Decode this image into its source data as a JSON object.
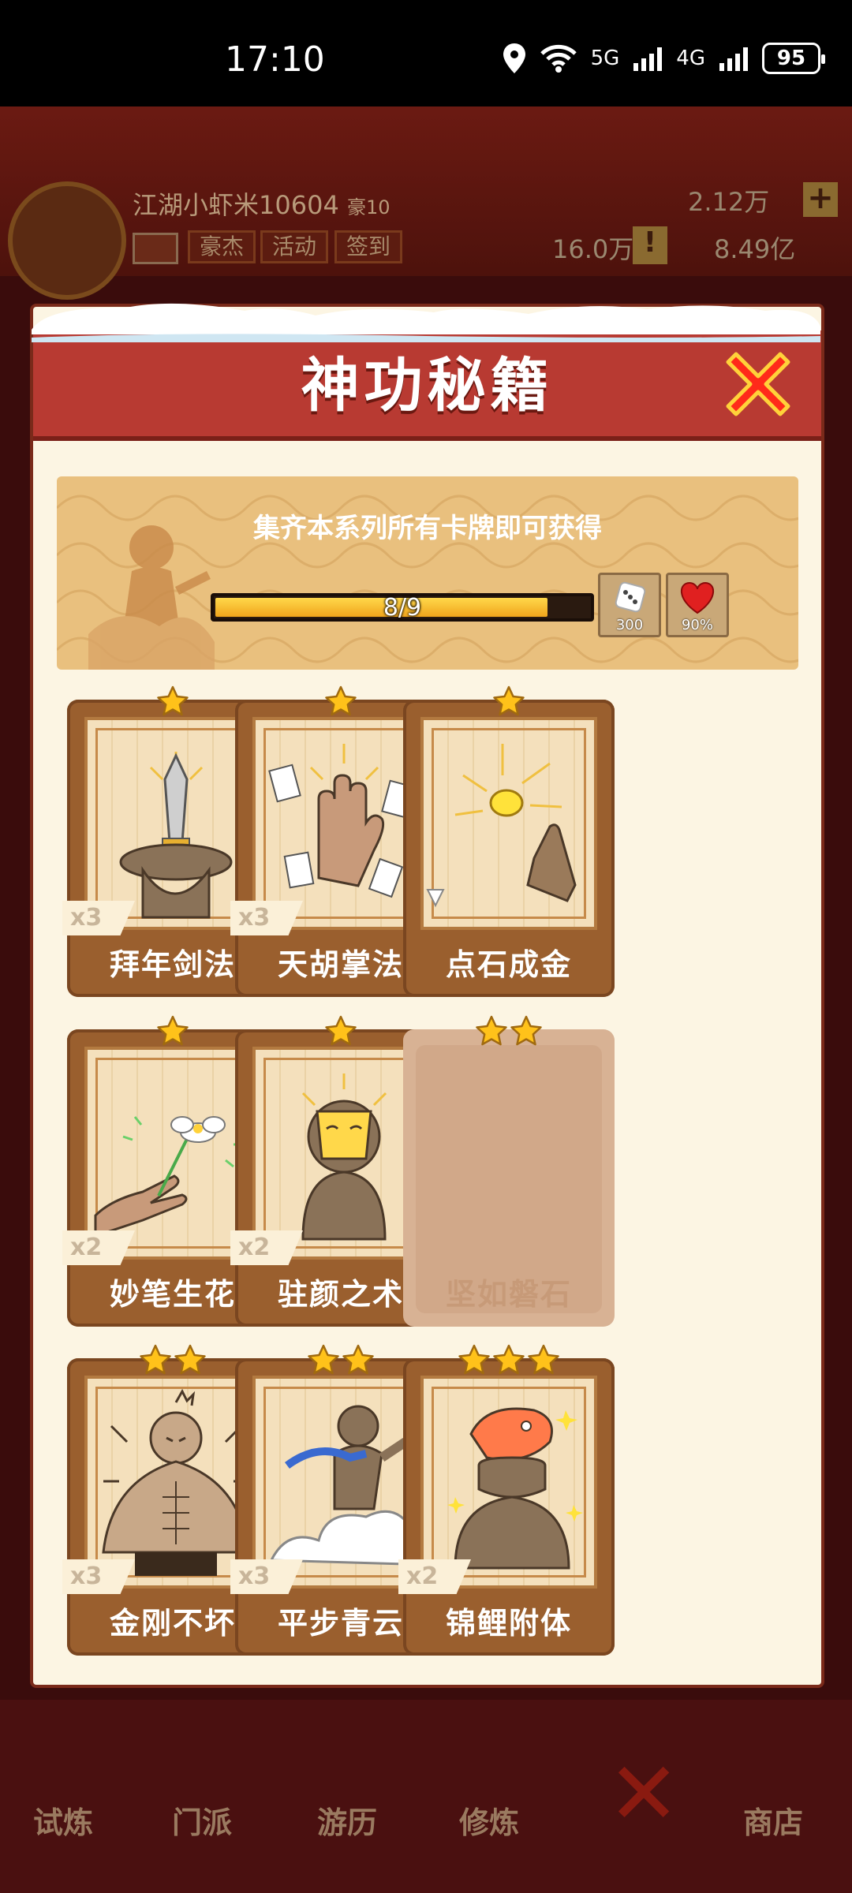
{
  "status_bar": {
    "time": "17:10",
    "network1": "5G",
    "network2": "4G",
    "battery": "95"
  },
  "background": {
    "username": "江湖小虾米10604",
    "level_badge": "豪10",
    "tags": [
      "豪杰",
      "活动",
      "签到"
    ],
    "gems": "2.12万",
    "tokens": "16.0万",
    "coins": "8.49亿",
    "nav": [
      "试炼",
      "门派",
      "游历",
      "修炼",
      "商店"
    ]
  },
  "modal": {
    "title": "神功秘籍",
    "collect": {
      "text": "集齐本系列所有卡牌即可获得",
      "progress_text": "8/9",
      "progress_fraction": 0.889,
      "rewards": [
        {
          "icon": "dice-icon",
          "label": "300"
        },
        {
          "icon": "heart-icon",
          "label": "90%"
        }
      ]
    },
    "cards": [
      {
        "name": "拜年剑法",
        "count": "x3",
        "stars": 1,
        "locked": false,
        "art": "sword"
      },
      {
        "name": "天胡掌法",
        "count": "x3",
        "stars": 1,
        "locked": false,
        "art": "palm"
      },
      {
        "name": "点石成金",
        "count": "",
        "stars": 1,
        "locked": false,
        "art": "gold"
      },
      {
        "name": "妙笔生花",
        "count": "x2",
        "stars": 1,
        "locked": false,
        "art": "flower"
      },
      {
        "name": "驻颜之术",
        "count": "x2",
        "stars": 1,
        "locked": false,
        "art": "mask"
      },
      {
        "name": "坚如磐石",
        "count": "",
        "stars": 2,
        "locked": true,
        "art": "none"
      },
      {
        "name": "金刚不坏",
        "count": "x3",
        "stars": 2,
        "locked": false,
        "art": "muscle"
      },
      {
        "name": "平步青云",
        "count": "x3",
        "stars": 2,
        "locked": false,
        "art": "cloud"
      },
      {
        "name": "锦鲤附体",
        "count": "x2",
        "stars": 3,
        "locked": false,
        "art": "koi"
      }
    ]
  },
  "colors": {
    "header_red": "#b83a32",
    "card_brown": "#9a5f2e",
    "star_gold": "#ffc21a",
    "progress_gold": "#f0a41c"
  }
}
